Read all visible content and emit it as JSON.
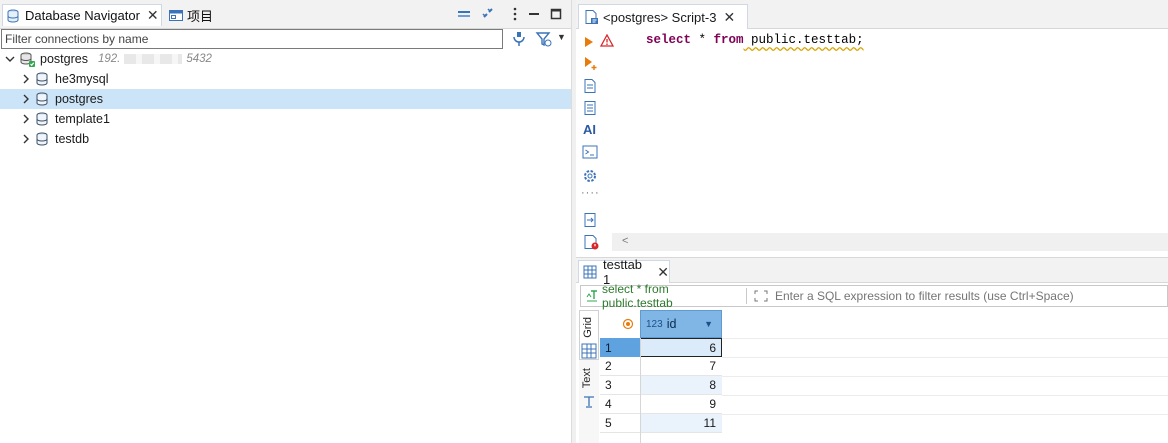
{
  "navigator": {
    "tab_label": "Database Navigator",
    "project_tab_label": "项目",
    "filter_placeholder": "Filter connections by name",
    "connection": {
      "name": "postgres",
      "host_prefix": "192.",
      "port": "5432"
    },
    "databases": [
      {
        "label": "he3mysql"
      },
      {
        "label": "postgres",
        "selected": true
      },
      {
        "label": "template1"
      },
      {
        "label": "testdb"
      }
    ]
  },
  "editor": {
    "tab_label": "<postgres> Script-3",
    "code": {
      "kw1": "select",
      "mid": " * ",
      "kw2": "from",
      "rest": " public.testtab;"
    }
  },
  "results": {
    "tab_label": "testtab 1",
    "query_label": "select * from public.testtab",
    "filter_placeholder": "Enter a SQL expression to filter results (use Ctrl+Space)",
    "side_tabs": {
      "grid": "Grid",
      "text": "Text"
    },
    "column": {
      "type_badge": "123",
      "name": "id"
    },
    "rows": [
      {
        "num": "1",
        "id": "6",
        "selected": true
      },
      {
        "num": "2",
        "id": "7"
      },
      {
        "num": "3",
        "id": "8"
      },
      {
        "num": "4",
        "id": "9"
      },
      {
        "num": "5",
        "id": "11"
      }
    ]
  },
  "colors": {
    "selection": "#cce4f7",
    "header_blue": "#7fb6e6",
    "row_header_selected": "#5ea3e0",
    "keyword": "#7f0055",
    "accent_orange": "#e87b0c"
  }
}
